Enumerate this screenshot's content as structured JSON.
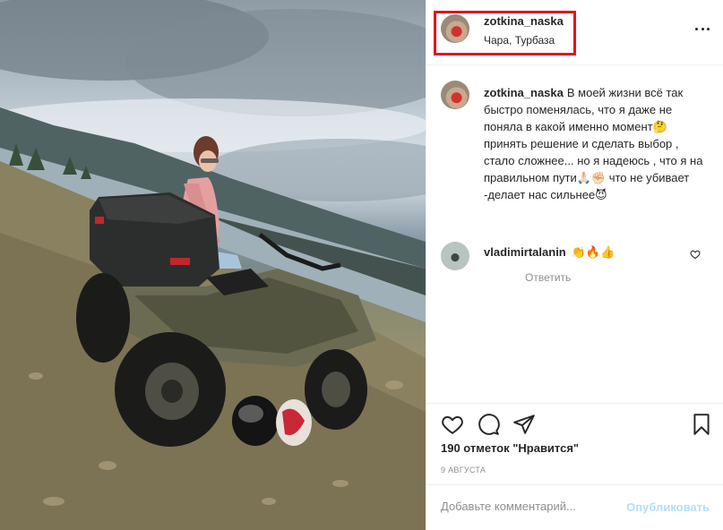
{
  "header": {
    "username": "zotkina_naska",
    "location": "Чара, Турбаза"
  },
  "caption": {
    "username": "zotkina_naska",
    "text": "В моей жизни всё так быстро поменялась, что я даже не поняла в какой именно момент🤔 принять решение и сделать выбор , стало сложнее... но я надеюсь , что я на правильном пути🙏🏻✊🏻 что не убивает -делает нас сильнее😈"
  },
  "comments": [
    {
      "username": "vladimirtalanin",
      "text": "👏🔥👍",
      "reply_label": "Ответить"
    }
  ],
  "actions": {
    "likes_text": "190 отметок \"Нравится\"",
    "date": "9 августа"
  },
  "add_comment": {
    "placeholder": "Добавьте комментарий...",
    "post_label": "Опубликовать"
  },
  "icons": {
    "more": "more-options-icon",
    "like": "heart-icon",
    "comment": "comment-icon",
    "share": "share-icon",
    "save": "bookmark-icon"
  },
  "colors": {
    "highlight": "#e5141b",
    "post_button": "#b2dffc",
    "muted": "#8e8e8e",
    "text": "#262626"
  }
}
